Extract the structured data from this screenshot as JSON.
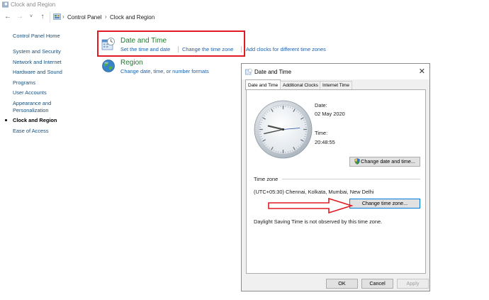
{
  "window": {
    "title": "Clock and Region"
  },
  "breadcrumb": {
    "items": [
      "Control Panel",
      "Clock and Region"
    ]
  },
  "sidebar": {
    "items": [
      {
        "label": "Control Panel Home"
      },
      {
        "label": "System and Security"
      },
      {
        "label": "Network and Internet"
      },
      {
        "label": "Hardware and Sound"
      },
      {
        "label": "Programs"
      },
      {
        "label": "User Accounts"
      },
      {
        "label": "Appearance and"
      },
      {
        "label": "Personalization"
      },
      {
        "label": "Clock and Region"
      },
      {
        "label": "Ease of Access"
      }
    ]
  },
  "main": {
    "date_time": {
      "title": "Date and Time",
      "links": [
        "Set the time and date",
        "Change the time zone",
        "Add clocks for different time zones"
      ]
    },
    "region": {
      "title": "Region",
      "links": [
        "Change date, time, or number formats"
      ]
    }
  },
  "dialog": {
    "title": "Date and Time",
    "tabs": [
      "Date and Time",
      "Additional Clocks",
      "Internet Time"
    ],
    "date_label": "Date:",
    "date_value": "02 May 2020",
    "time_label": "Time:",
    "time_value": "20:48:55",
    "change_datetime_button": "Change date and time...",
    "timezone_heading": "Time zone",
    "timezone_value": "(UTC+05:30) Chennai, Kolkata, Mumbai, New Delhi",
    "change_timezone_button": "Change time zone...",
    "dst_note": "Daylight Saving Time is not observed by this time zone.",
    "ok_button": "OK",
    "cancel_button": "Cancel",
    "apply_button": "Apply"
  },
  "colors": {
    "link": "#1f5fa6",
    "category_title": "#1e7a2e",
    "highlight": "#e01b24"
  }
}
